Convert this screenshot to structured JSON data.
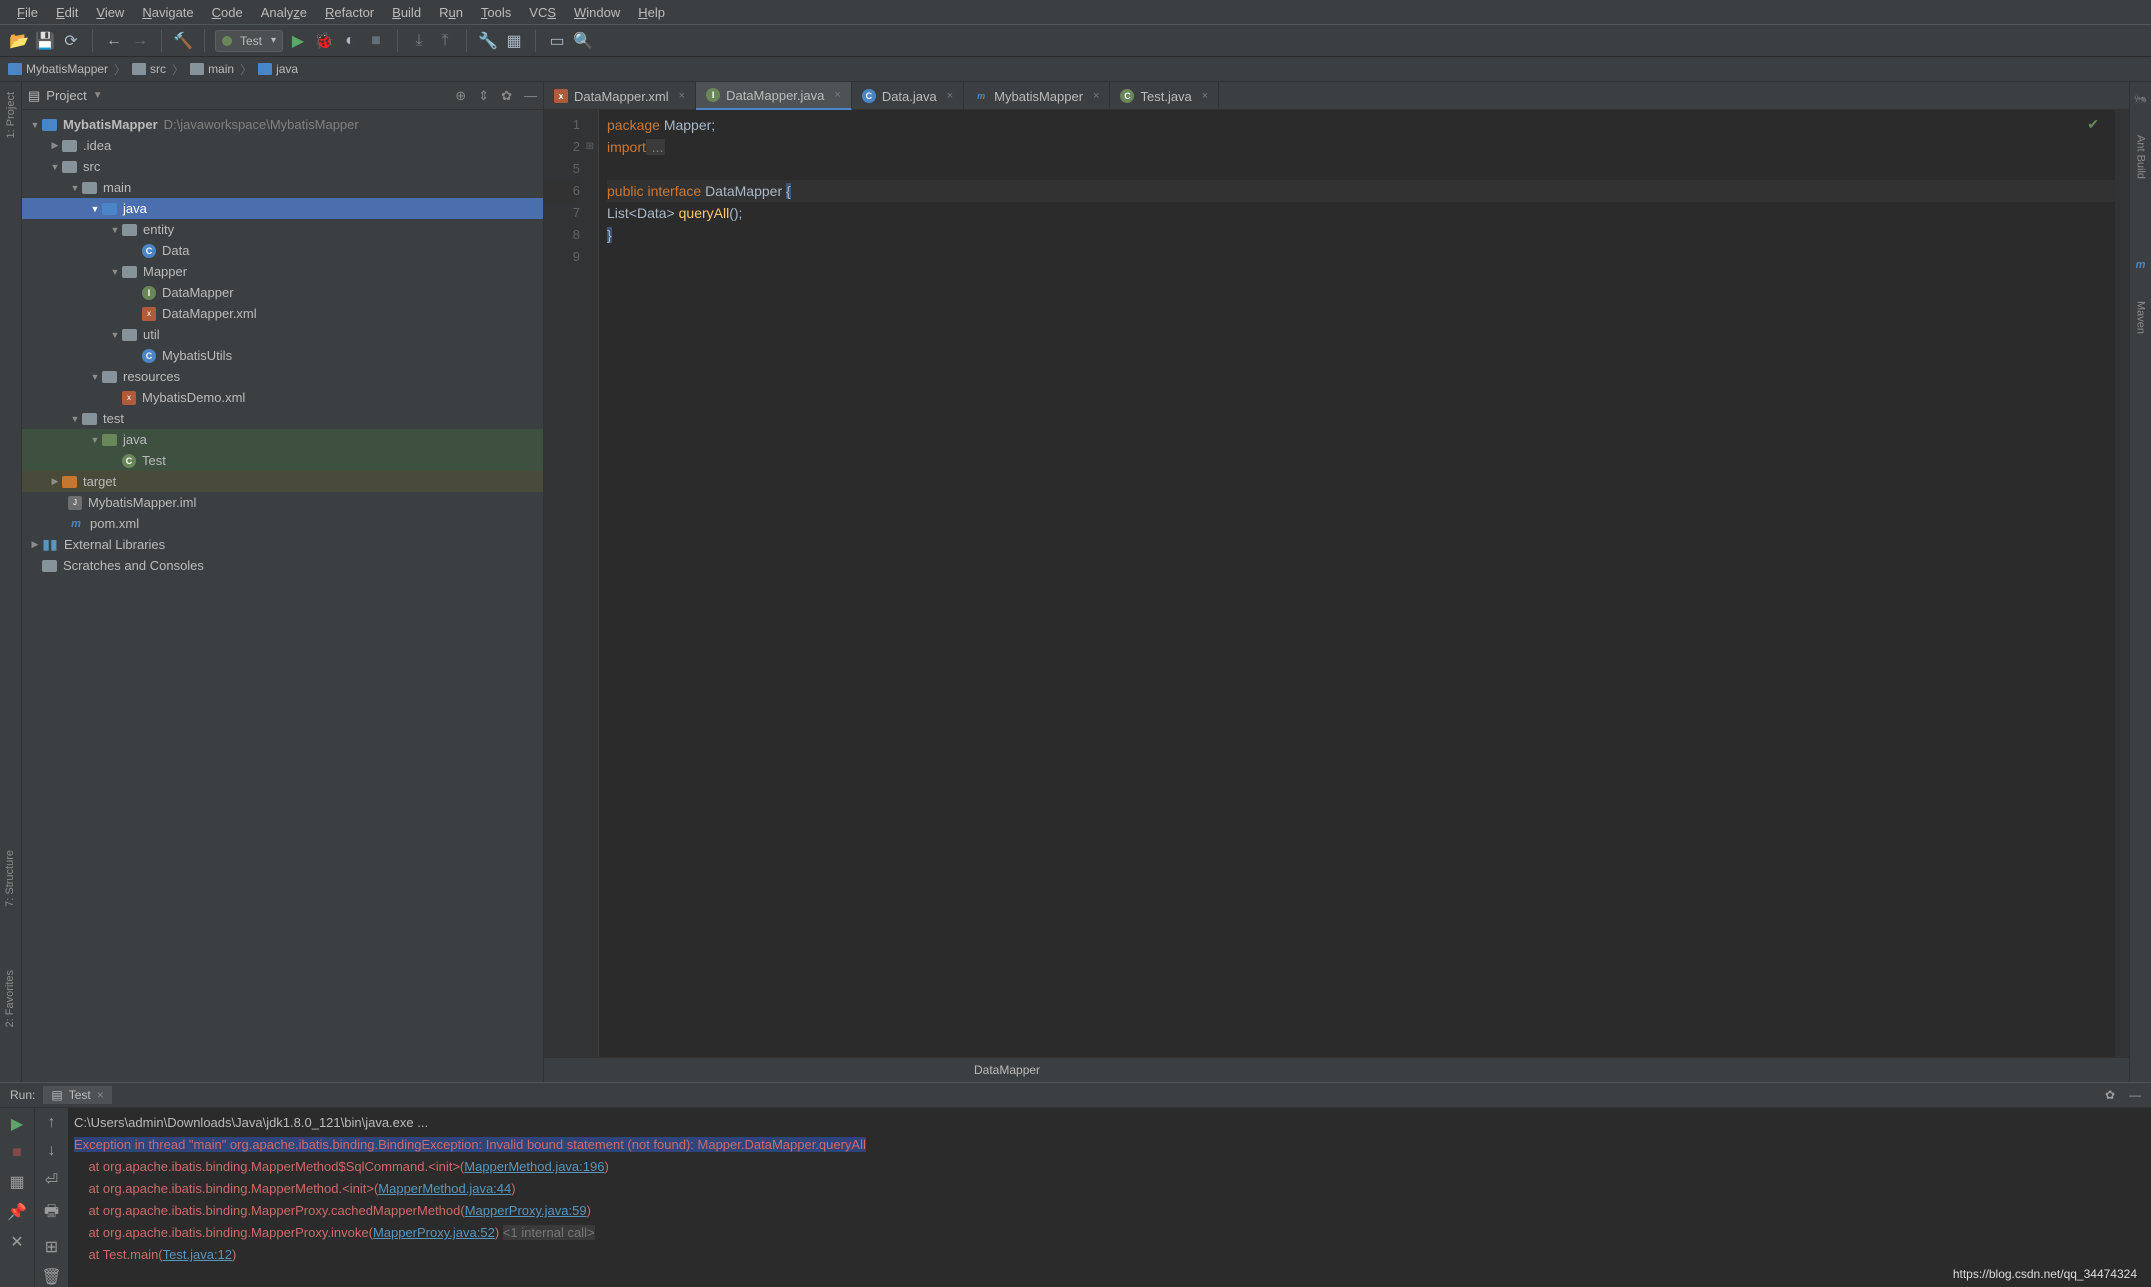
{
  "menu": {
    "file": "File",
    "edit": "Edit",
    "view": "View",
    "navigate": "Navigate",
    "code": "Code",
    "analyze": "Analyze",
    "refactor": "Refactor",
    "build": "Build",
    "run": "Run",
    "tools": "Tools",
    "vcs": "VCS",
    "window": "Window",
    "help": "Help"
  },
  "toolbar": {
    "run_config": "Test"
  },
  "breadcrumb": {
    "root": "MybatisMapper",
    "p1": "src",
    "p2": "main",
    "p3": "java"
  },
  "left_stripe": {
    "project": "1: Project",
    "structure": "7: Structure",
    "favorites": "2: Favorites"
  },
  "right_stripe": {
    "ant": "Ant Build",
    "maven": "Maven"
  },
  "project_panel": {
    "title": "Project",
    "root": "MybatisMapper",
    "root_path": "D:\\javaworkspace\\MybatisMapper",
    "idea": ".idea",
    "src": "src",
    "main": "main",
    "java": "java",
    "entity": "entity",
    "data": "Data",
    "mapper_pkg": "Mapper",
    "datamapper_if": "DataMapper",
    "datamapper_xml": "DataMapper.xml",
    "util": "util",
    "mybatisutils": "MybatisUtils",
    "resources": "resources",
    "mybatisdemo": "MybatisDemo.xml",
    "test": "test",
    "test_java": "java",
    "test_class": "Test",
    "target": "target",
    "iml": "MybatisMapper.iml",
    "pom": "pom.xml",
    "ext_lib": "External Libraries",
    "scratches": "Scratches and Consoles"
  },
  "tabs": {
    "t0": "DataMapper.xml",
    "t1": "DataMapper.java",
    "t2": "Data.java",
    "t3": "MybatisMapper",
    "t4": "Test.java"
  },
  "code": {
    "ln1": "1",
    "ln2": "2",
    "ln5": "5",
    "ln6": "6",
    "ln7": "7",
    "ln8": "8",
    "ln9": "9",
    "package_kw": "package",
    "package_name": " Mapper",
    "import_kw": "import",
    "import_dots": " ...",
    "public_kw": "public ",
    "interface_kw": "interface ",
    "classname": "DataMapper ",
    "obrace": "{",
    "list": "    List",
    "generic": "<Data> ",
    "method": "queryAll",
    "tail": "();",
    "cbrace": "}"
  },
  "editor_status": "DataMapper",
  "run": {
    "label": "Run:",
    "tab": "Test",
    "l0": "C:\\Users\\admin\\Downloads\\Java\\jdk1.8.0_121\\bin\\java.exe ...",
    "l1": "Exception in thread \"main\" org.apache.ibatis.binding.BindingException: Invalid bound statement (not found): Mapper.DataMapper.queryAll",
    "l2a": "    at org.apache.ibatis.binding.MapperMethod$SqlCommand.",
    "l2init": "<init>",
    "l2b": "(",
    "l2link": "MapperMethod.java:196",
    "l2c": ")",
    "l3a": "    at org.apache.ibatis.binding.MapperMethod.",
    "l3init": "<init>",
    "l3b": "(",
    "l3link": "MapperMethod.java:44",
    "l3c": ")",
    "l4a": "    at org.apache.ibatis.binding.MapperProxy.cachedMapperMethod(",
    "l4link": "MapperProxy.java:59",
    "l4c": ")",
    "l5a": "    at org.apache.ibatis.binding.MapperProxy.invoke(",
    "l5link": "MapperProxy.java:52",
    "l5c": ") ",
    "l5int": "<1 internal call>",
    "l6a": "    at Test.main(",
    "l6link": "Test.java:12",
    "l6c": ")"
  },
  "watermark": "https://blog.csdn.net/qq_34474324"
}
